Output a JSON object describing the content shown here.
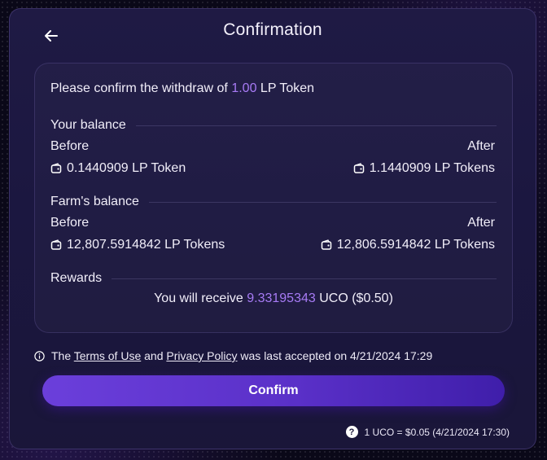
{
  "header": {
    "title": "Confirmation",
    "back_icon": "arrow-left-icon"
  },
  "withdraw": {
    "prefix": "Please confirm the withdraw of ",
    "amount": "1.00",
    "unit": " LP Token"
  },
  "your_balance": {
    "label": "Your balance",
    "before_label": "Before",
    "after_label": "After",
    "before_value": "0.1440909 LP Token",
    "after_value": "1.1440909 LP Tokens"
  },
  "farm_balance": {
    "label": "Farm's balance",
    "before_label": "Before",
    "after_label": "After",
    "before_value": "12,807.5914842 LP Tokens",
    "after_value": "12,806.5914842 LP Tokens"
  },
  "rewards": {
    "label": "Rewards",
    "prefix": "You will receive ",
    "amount": "9.33195343",
    "suffix": " UCO ($0.50)"
  },
  "terms": {
    "icon": "info-icon",
    "text_1": "The ",
    "terms_link": "Terms of Use",
    "text_2": " and ",
    "privacy_link": "Privacy Policy",
    "text_3": " was last accepted on 4/21/2024 17:29"
  },
  "confirm_button_label": "Confirm",
  "price_footer": {
    "help_icon_glyph": "?",
    "text": "1 UCO = $0.05 (4/21/2024 17:30)"
  },
  "colors": {
    "accent": "#a77bf5",
    "button": "#5a30c8",
    "background": "#1b1740"
  }
}
